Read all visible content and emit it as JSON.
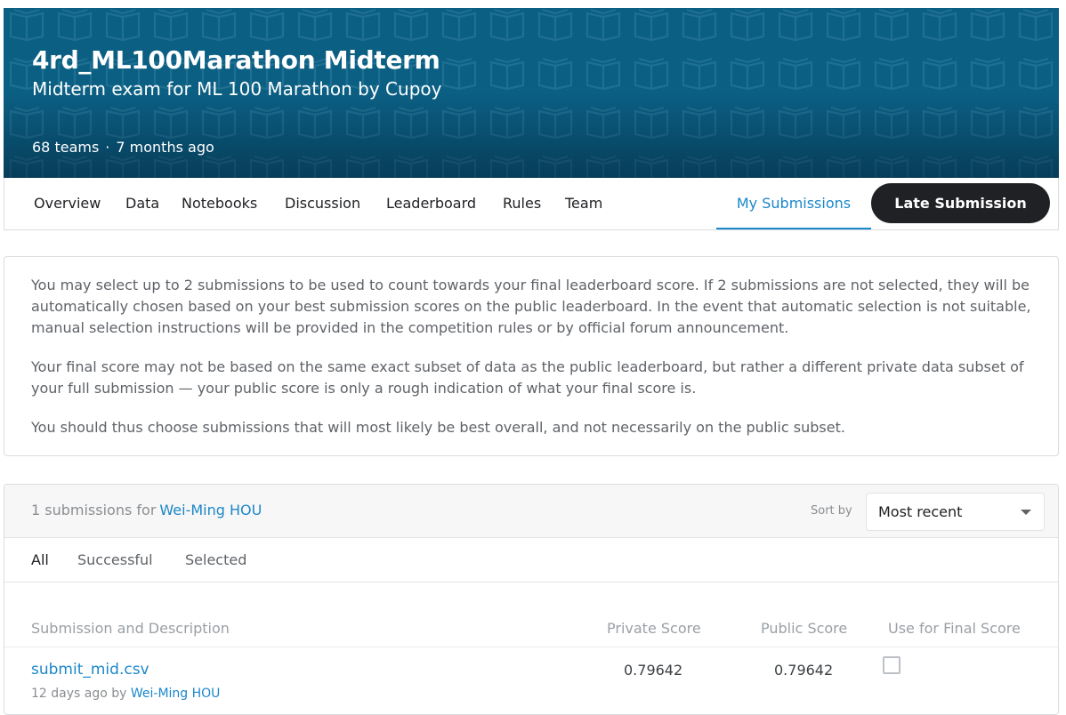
{
  "banner": {
    "title": "4rd_ML100Marathon Midterm",
    "subtitle": "Midterm exam for ML 100 Marathon by Cupoy",
    "teams": "68 teams",
    "separator": "·",
    "age": "7 months ago",
    "background_color": "#0b5f83",
    "pattern_icon": "book-pattern-icon"
  },
  "nav": {
    "tabs": [
      "Overview",
      "Data",
      "Notebooks",
      "Discussion",
      "Leaderboard",
      "Rules",
      "Team"
    ],
    "my_submissions": "My Submissions",
    "late_submission": "Late Submission",
    "accent_color": "#1b87c9"
  },
  "info": {
    "paragraphs": [
      "You may select up to 2 submissions to be used to count towards your final leaderboard score. If 2 submissions are not selected, they will be automatically chosen based on your best submission scores on the public leaderboard. In the event that automatic selection is not suitable, manual selection instructions will be provided in the competition rules or by official forum announcement.",
      "Your final score may not be based on the same exact subset of data as the public leaderboard, but rather a different private data subset of your full submission — your public score is only a rough indication of what your final score is.",
      "You should thus choose submissions that will most likely be best overall, and not necessarily on the public subset."
    ]
  },
  "submissions": {
    "count_text": "1 submissions for",
    "user": "Wei-Ming HOU",
    "sort_label": "Sort by",
    "sort_value": "Most recent",
    "filters": [
      "All",
      "Successful",
      "Selected"
    ],
    "columns": {
      "description": "Submission and Description",
      "private": "Private Score",
      "public": "Public Score",
      "final": "Use for Final Score"
    },
    "rows": [
      {
        "file": "submit_mid.csv",
        "meta_prefix": "12 days ago by",
        "user": "Wei-Ming HOU",
        "private_score": "0.79642",
        "public_score": "0.79642"
      }
    ]
  }
}
